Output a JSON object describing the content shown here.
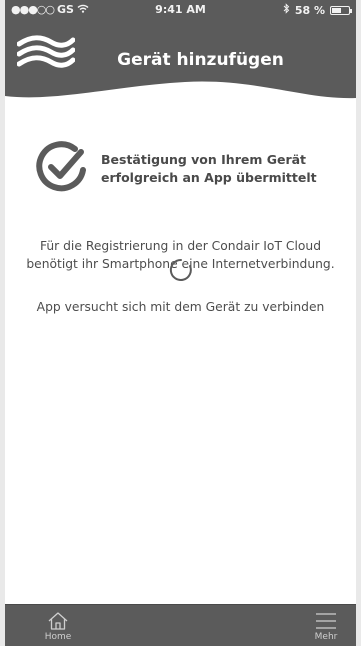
{
  "status_bar": {
    "signal_dots": "●●●○○",
    "carrier": "GS",
    "wifi_icon": "wifi-icon",
    "time": "9:41 AM",
    "bluetooth_icon": "bluetooth-icon",
    "battery_text": "58 %",
    "battery_level_fraction": 0.58
  },
  "header": {
    "title": "Gerät hinzufügen",
    "logo_icon": "condair-wave-logo-icon"
  },
  "confirmation": {
    "icon": "checkmark-circle-icon",
    "line1": "Bestätigung von Ihrem Gerät",
    "line2": "erfolgreich an App übermittelt"
  },
  "info": {
    "line1": "Für die Registrierung in der Condair IoT Cloud",
    "line2": "benötigt ihr Smartphone eine Internetverbindung."
  },
  "progress": {
    "icon": "loading-spinner-icon",
    "status_text": "App versucht sich mit dem Gerät zu verbinden"
  },
  "tab_bar": {
    "home_label": "Home",
    "home_icon": "home-icon",
    "more_label": "Mehr",
    "more_icon": "menu-icon"
  },
  "colors": {
    "dark_gray": "#5b5b5b",
    "text_gray": "#4d4d4d",
    "background": "#ffffff"
  }
}
